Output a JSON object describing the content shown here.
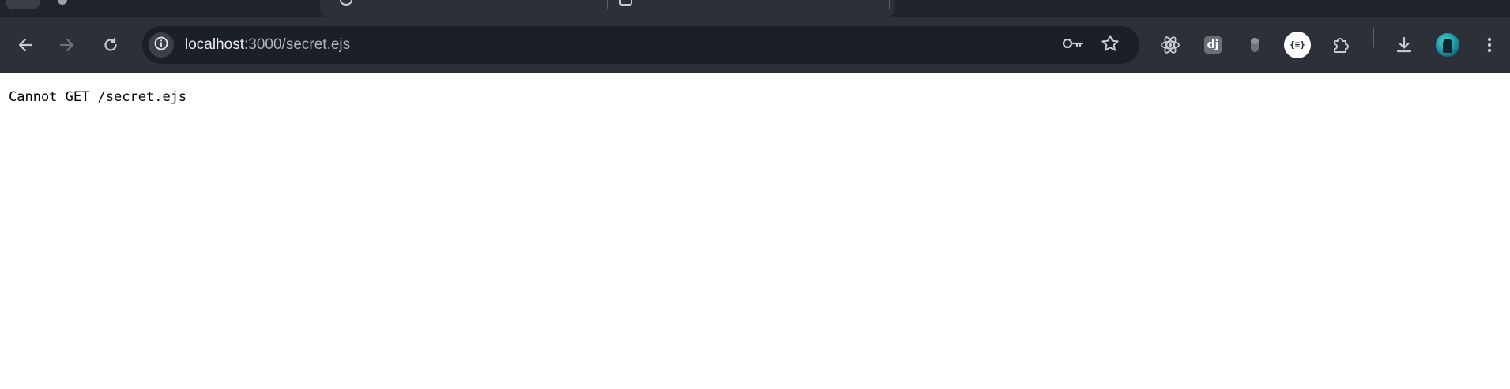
{
  "browser": {
    "address_bar": {
      "host": "localhost",
      "path": ":3000/secret.ejs"
    },
    "icons": {
      "back": "arrow-left-icon",
      "forward": "arrow-right-icon",
      "reload": "reload-icon",
      "site_info": "info-icon",
      "password": "key-icon",
      "bookmark": "star-icon",
      "react_devtools": "react-atom-icon",
      "django": "django-icon",
      "extension_grey": "capsule-icon",
      "json_viewer": "json-braces-icon",
      "extensions": "puzzle-icon",
      "downloads": "download-icon",
      "profile": "avatar-icon",
      "menu": "kebab-menu-icon"
    },
    "extension_badges": {
      "django": "dj",
      "json": "{≡}"
    },
    "colors": {
      "chrome_dark": "#2b3039",
      "omnibox_bg": "#1b1f26",
      "icon": "#c7cad1"
    }
  },
  "page": {
    "message": "Cannot GET /secret.ejs"
  }
}
